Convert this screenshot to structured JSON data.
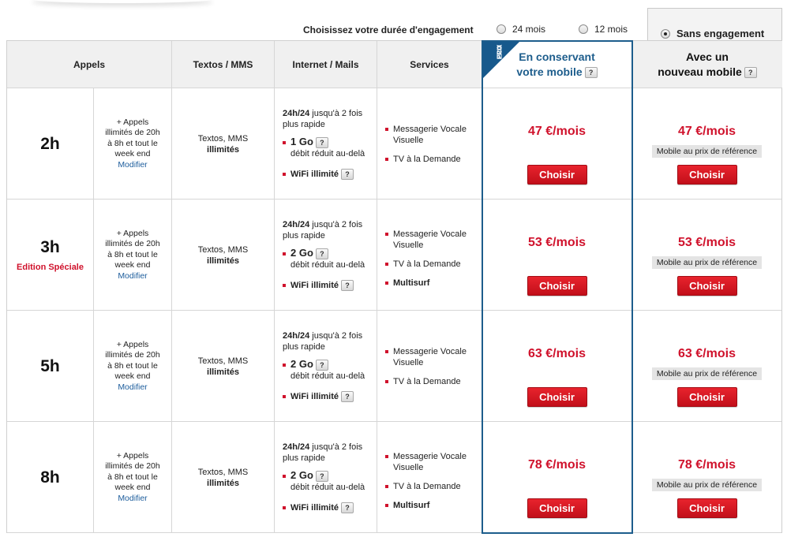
{
  "engagement": {
    "label": "Choisissez votre durée d'engagement",
    "options": [
      {
        "label": "24 mois",
        "selected": false
      },
      {
        "label": "12 mois",
        "selected": false
      },
      {
        "label": "Sans engagement",
        "selected": true
      }
    ]
  },
  "headers": {
    "appels": "Appels",
    "textos": "Textos / MMS",
    "internet": "Internet / Mails",
    "services": "Services",
    "conserve_line1": "En conservant",
    "conserve_line2": "votre mobile",
    "nouveau_line1": "Avec un",
    "nouveau_line2": "nouveau mobile",
    "eco_badge_line1": "PRIX",
    "eco_badge_line2": "ECO"
  },
  "help_glyph": "?",
  "colors": {
    "accent_red": "#d0122c",
    "eco_blue": "#1d5d8c"
  },
  "rows": [
    {
      "duration": "2h",
      "special": "",
      "appels": [
        "+ Appels",
        "illimités de 20h",
        "à 8h et tout le",
        "week end"
      ],
      "modifier": "Modifier",
      "textos": "Textos, MMS",
      "textos_bold": "illimités",
      "speed_a": "24h/24",
      "speed_b": " jusqu'à 2 fois plus rapide",
      "data": "1 Go",
      "reduit": "débit réduit au-delà",
      "wifi": "WiFi illimité",
      "services": [
        "Messagerie Vocale Visuelle",
        "TV à la Demande"
      ],
      "services_bold": "",
      "price_conserve": "47 €/mois",
      "price_nouveau": "47 €/mois",
      "ref": "Mobile au prix de référence",
      "button": "Choisir"
    },
    {
      "duration": "3h",
      "special": "Edition Spéciale",
      "appels": [
        "+ Appels",
        "illimités de 20h",
        "à 8h et tout le",
        "week end"
      ],
      "modifier": "Modifier",
      "textos": "Textos, MMS",
      "textos_bold": "illimités",
      "speed_a": "24h/24",
      "speed_b": " jusqu'à 2 fois plus rapide",
      "data": "2 Go",
      "reduit": "débit réduit au-delà",
      "wifi": "WiFi illimité",
      "services": [
        "Messagerie Vocale Visuelle",
        "TV à la Demande"
      ],
      "services_bold": "Multisurf",
      "price_conserve": "53 €/mois",
      "price_nouveau": "53 €/mois",
      "ref": "Mobile au prix de référence",
      "button": "Choisir"
    },
    {
      "duration": "5h",
      "special": "",
      "appels": [
        "+ Appels",
        "illimités de 20h",
        "à 8h et tout le",
        "week end"
      ],
      "modifier": "Modifier",
      "textos": "Textos, MMS",
      "textos_bold": "illimités",
      "speed_a": "24h/24",
      "speed_b": " jusqu'à 2 fois plus rapide",
      "data": "2 Go",
      "reduit": "débit réduit au-delà",
      "wifi": "WiFi illimité",
      "services": [
        "Messagerie Vocale Visuelle",
        "TV à la Demande"
      ],
      "services_bold": "",
      "price_conserve": "63 €/mois",
      "price_nouveau": "63 €/mois",
      "ref": "Mobile au prix de référence",
      "button": "Choisir"
    },
    {
      "duration": "8h",
      "special": "",
      "appels": [
        "+ Appels",
        "illimités de 20h",
        "à 8h et tout le",
        "week end"
      ],
      "modifier": "Modifier",
      "textos": "Textos, MMS",
      "textos_bold": "illimités",
      "speed_a": "24h/24",
      "speed_b": " jusqu'à 2 fois plus rapide",
      "data": "2 Go",
      "reduit": "débit réduit au-delà",
      "wifi": "WiFi illimité",
      "services": [
        "Messagerie Vocale Visuelle",
        "TV à la Demande"
      ],
      "services_bold": "Multisurf",
      "price_conserve": "78 €/mois",
      "price_nouveau": "78 €/mois",
      "ref": "Mobile au prix de référence",
      "button": "Choisir"
    }
  ]
}
